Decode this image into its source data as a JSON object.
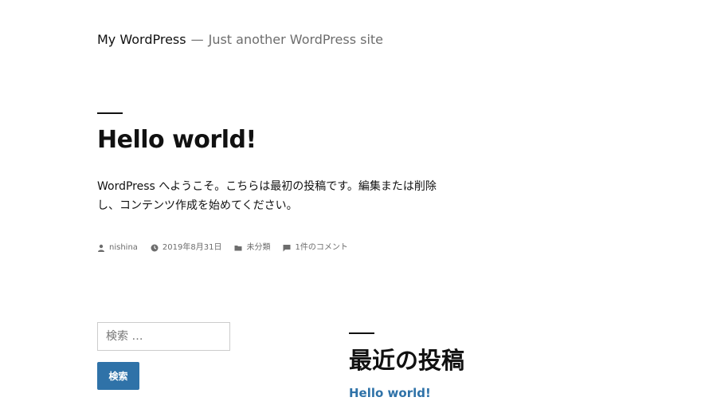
{
  "header": {
    "site_title": "My WordPress",
    "separator": "—",
    "tagline": "Just another WordPress site"
  },
  "post": {
    "title": "Hello world!",
    "content": "WordPress へようこそ。こちらは最初の投稿です。編集または削除し、コンテンツ作成を始めてください。",
    "meta": {
      "author": "nishina",
      "date": "2019年8月31日",
      "category": "未分類",
      "comments": "1件のコメント"
    }
  },
  "search": {
    "placeholder": "検索 …",
    "value": "",
    "button_label": "検索"
  },
  "recent_posts": {
    "heading": "最近の投稿",
    "items": [
      "Hello world!"
    ]
  },
  "colors": {
    "link": "#2f72a8",
    "text": "#111111",
    "muted": "#6d6d6d"
  }
}
